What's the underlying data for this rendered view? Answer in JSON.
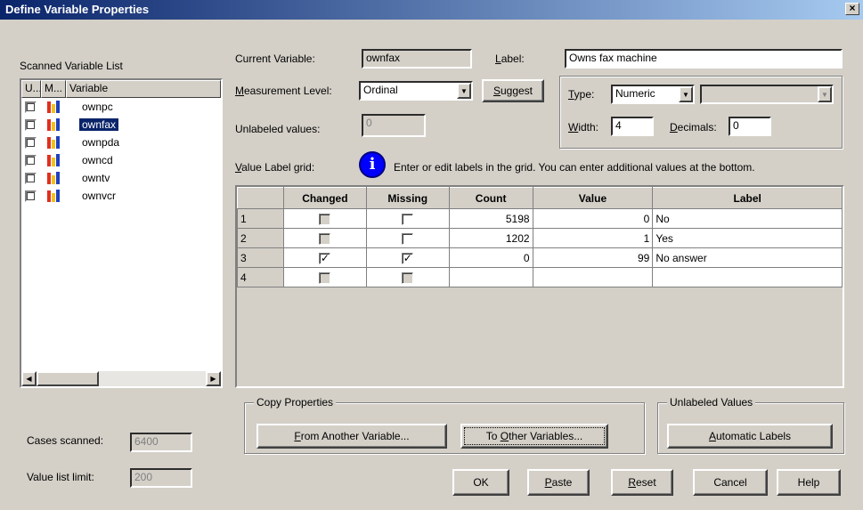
{
  "window": {
    "title": "Define Variable Properties",
    "close": "×"
  },
  "scanned": {
    "title": "Scanned Variable List",
    "col_u": "U...",
    "col_m": "M...",
    "col_variable": "Variable",
    "items": [
      {
        "name": "ownpc",
        "checked": false,
        "selected": false
      },
      {
        "name": "ownfax",
        "checked": false,
        "selected": true
      },
      {
        "name": "ownpda",
        "checked": false,
        "selected": false
      },
      {
        "name": "owncd",
        "checked": false,
        "selected": false
      },
      {
        "name": "owntv",
        "checked": false,
        "selected": false
      },
      {
        "name": "ownvcr",
        "checked": false,
        "selected": false
      }
    ]
  },
  "cases_scanned": {
    "label": "Cases scanned:",
    "value": "6400"
  },
  "value_list_limit": {
    "label": "Value list limit:",
    "value": "200"
  },
  "current_variable": {
    "label": "Current Variable:",
    "value": "ownfax"
  },
  "label_field": {
    "label": "Label:",
    "value": "Owns fax machine"
  },
  "measurement": {
    "label": "Measurement Level:",
    "value": "Ordinal"
  },
  "suggest_button": "Suggest",
  "type": {
    "label": "Type:",
    "value": "Numeric",
    "sub_value": ""
  },
  "width": {
    "label": "Width:",
    "value": "4"
  },
  "decimals": {
    "label": "Decimals:",
    "value": "0"
  },
  "unlabeled_values": {
    "label": "Unlabeled values:",
    "value": "0"
  },
  "value_label_grid": {
    "label": "Value Label grid:",
    "info": "Enter or edit labels in the grid.  You can enter additional values at the bottom.",
    "columns": [
      "Changed",
      "Missing",
      "Count",
      "Value",
      "Label"
    ],
    "rows": [
      {
        "num": "1",
        "changed": false,
        "missing": false,
        "count": "5198",
        "value": "0",
        "label": "No"
      },
      {
        "num": "2",
        "changed": false,
        "missing": false,
        "count": "1202",
        "value": "1",
        "label": "Yes"
      },
      {
        "num": "3",
        "changed": true,
        "missing": true,
        "count": "0",
        "value": "99",
        "label": "No answer"
      },
      {
        "num": "4",
        "changed": false,
        "missing": false,
        "count": "",
        "value": "",
        "label": ""
      }
    ]
  },
  "copy_properties": {
    "title": "Copy Properties",
    "from_button": "From Another Variable...",
    "to_button": "To Other Variables..."
  },
  "unlabeled_group": {
    "title": "Unlabeled Values",
    "auto_button": "Automatic Labels"
  },
  "buttons": {
    "ok": "OK",
    "paste": "Paste",
    "reset": "Reset",
    "cancel": "Cancel",
    "help": "Help"
  }
}
